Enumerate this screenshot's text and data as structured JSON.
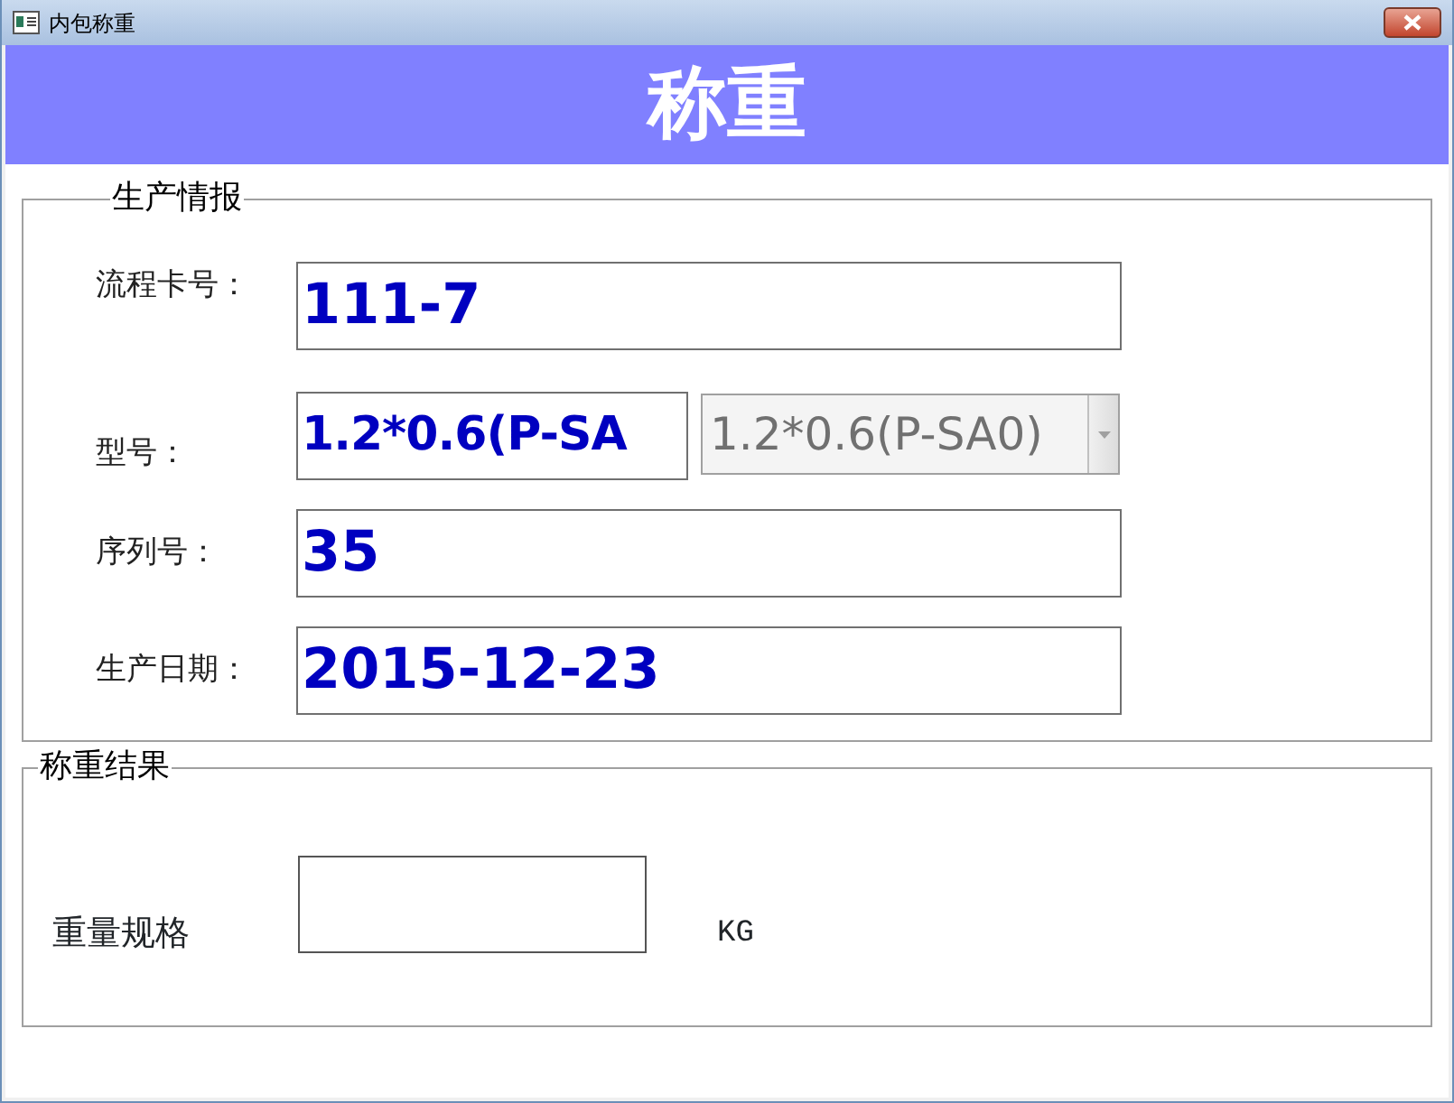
{
  "window": {
    "title": "内包称重"
  },
  "header": {
    "title": "称重"
  },
  "production_info": {
    "title": "生产情报",
    "fields": [
      {
        "label": "流程卡号：",
        "value": "111-7",
        "kind": "text"
      },
      {
        "label": "型号：",
        "value": "1.2*0.6(P-SA",
        "kind": "text_with_combo",
        "combo": {
          "value": "1.2*0.6(P-SA0)",
          "disabled": true
        }
      },
      {
        "label": "序列号：",
        "value": "35",
        "kind": "text"
      },
      {
        "label": "生产日期：",
        "value": "2015-12-23",
        "kind": "text"
      }
    ]
  },
  "weighing_result": {
    "title": "称重结果",
    "label": "重量规格",
    "unit": "KG"
  }
}
